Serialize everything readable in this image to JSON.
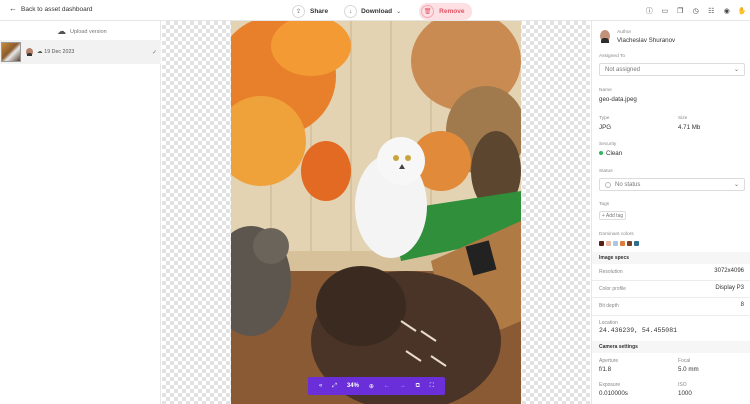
{
  "topbar": {
    "back_label": "Back to asset dashboard",
    "share_label": "Share",
    "download_label": "Download",
    "remove_label": "Remove",
    "right_icons": [
      "info-icon",
      "comment-icon",
      "versions-icon",
      "history-icon",
      "adjust-icon",
      "view-icon",
      "hand-icon"
    ]
  },
  "left": {
    "upload_label": "Upload version",
    "asset_date": "19 Dec 2023"
  },
  "zoom": {
    "level": "34%"
  },
  "details": {
    "author_label": "Author",
    "author_name": "Vlacheslav Shuranov",
    "assigned_label": "Assigned To",
    "assigned_value": "Not assigned",
    "name_label": "Name",
    "name_value": "geo-data.jpeg",
    "type_label": "Type",
    "type_value": "JPG",
    "size_label": "Size",
    "size_value": "4.71 Mb",
    "security_label": "Security",
    "security_value": "Clean",
    "status_label": "Status",
    "status_value": "No status",
    "tags_label": "Tags",
    "add_tag_label": "+ Add tag",
    "colors_label": "Dominant colors",
    "colors": [
      "#5a1d12",
      "#e9b9a3",
      "#a7c8e0",
      "#e07b3a",
      "#7a3f24",
      "#2e6e8c"
    ]
  },
  "image_specs": {
    "header": "Image specs",
    "resolution_label": "Resolution",
    "resolution_value": "3072x4096",
    "profile_label": "Color profile",
    "profile_value": "Display P3",
    "bitdepth_label": "Bit depth",
    "bitdepth_value": "8",
    "location_label": "Location",
    "location_value": "24.436239, 54.455081"
  },
  "camera": {
    "header": "Camera settings",
    "aperture_label": "Aperture",
    "aperture_value": "f/1.8",
    "focal_label": "Focal",
    "focal_value": "5.0 mm",
    "exposure_label": "Exposure",
    "exposure_value": "0.010000s",
    "iso_label": "ISO",
    "iso_value": "1000"
  }
}
